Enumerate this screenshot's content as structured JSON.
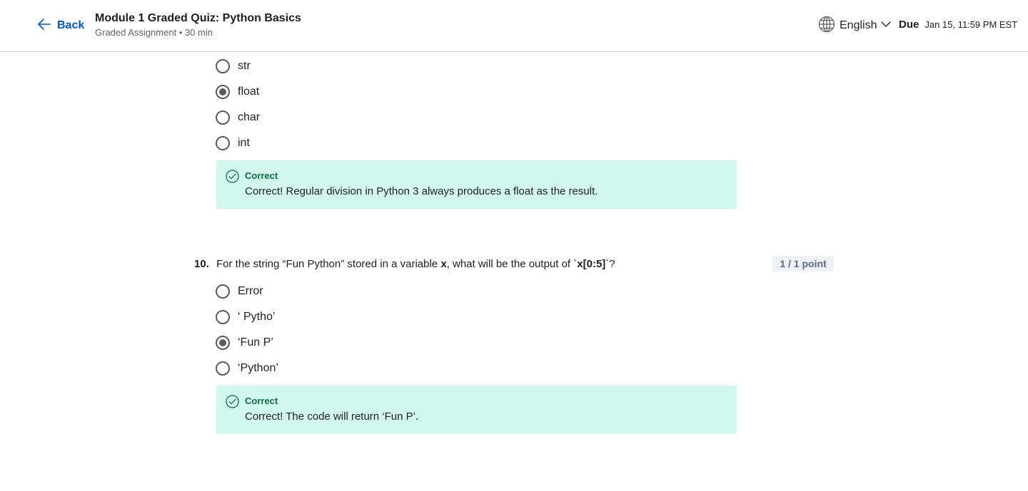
{
  "header": {
    "back_label": "Back",
    "title": "Module 1 Graded Quiz: Python Basics",
    "subtitle": "Graded Assignment • 30 min",
    "language": "English",
    "due_label": "Due",
    "due_date": "Jan 15, 11:59 PM EST"
  },
  "question9": {
    "options": [
      {
        "label": "str",
        "selected": false
      },
      {
        "label": "float",
        "selected": true
      },
      {
        "label": "char",
        "selected": false
      },
      {
        "label": "int",
        "selected": false
      }
    ],
    "feedback": {
      "status": "Correct",
      "text": "Correct! Regular division in Python 3 always produces a float as the result."
    }
  },
  "question10": {
    "number": "10.",
    "text_before": "For the string “Fun Python” stored in a variable ",
    "var": "x",
    "text_middle": ", what will be the output of `",
    "code": "x[0:5]",
    "text_after": "`?",
    "points": "1 / 1 point",
    "options": [
      {
        "label": "Error",
        "selected": false
      },
      {
        "label": "‘ Pytho’",
        "selected": false
      },
      {
        "label": "‘Fun P’",
        "selected": true
      },
      {
        "label": "‘Python’",
        "selected": false
      }
    ],
    "feedback": {
      "status": "Correct",
      "text": "Correct! The code will return ‘Fun P’."
    }
  },
  "colors": {
    "accent": "#0056d2",
    "correct_bg": "#d1f8ed",
    "correct_text": "#0b6b46"
  },
  "icons": {
    "back": "arrow-left-icon",
    "language": "globe-icon",
    "dropdown": "chevron-down-icon",
    "feedback": "check-circle-icon"
  }
}
